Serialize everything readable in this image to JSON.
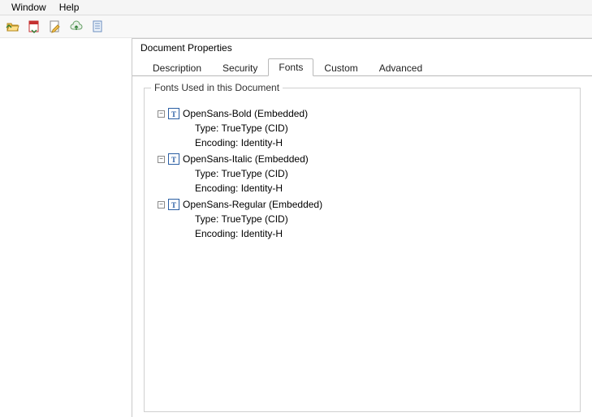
{
  "menubar": {
    "items": [
      "Window",
      "Help"
    ]
  },
  "toolbar": {
    "icons": [
      "open-folder-icon",
      "save-pdf-icon",
      "edit-icon",
      "cloud-upload-icon",
      "page-icon"
    ]
  },
  "dialog": {
    "title": "Document Properties",
    "tabs": {
      "items": [
        "Description",
        "Security",
        "Fonts",
        "Custom",
        "Advanced"
      ],
      "active_index": 2
    },
    "fonts_panel": {
      "group_label": "Fonts Used in this Document",
      "type_label_prefix": "Type: ",
      "encoding_label_prefix": "Encoding: ",
      "fonts": [
        {
          "name": "OpenSans-Bold (Embedded)",
          "type": "TrueType (CID)",
          "encoding": "Identity-H"
        },
        {
          "name": "OpenSans-Italic (Embedded)",
          "type": "TrueType (CID)",
          "encoding": "Identity-H"
        },
        {
          "name": "OpenSans-Regular (Embedded)",
          "type": "TrueType (CID)",
          "encoding": "Identity-H"
        }
      ]
    }
  }
}
